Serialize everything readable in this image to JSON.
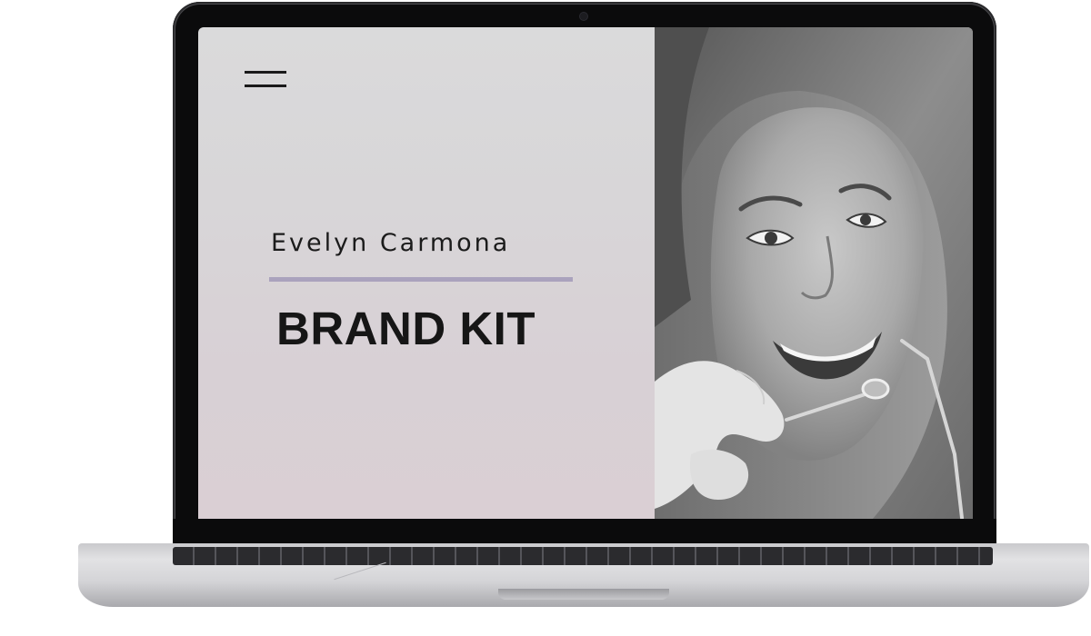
{
  "screen": {
    "left_panel": {
      "menu_icon": "hamburger-menu-icon",
      "name": "Evelyn Carmona",
      "title": "BRAND KIT",
      "accent_color": "#aaa2bd"
    },
    "photo": {
      "subject": "photo-of-smiling-woman-at-dental-checkup"
    }
  },
  "device": {
    "type": "laptop-mockup"
  }
}
